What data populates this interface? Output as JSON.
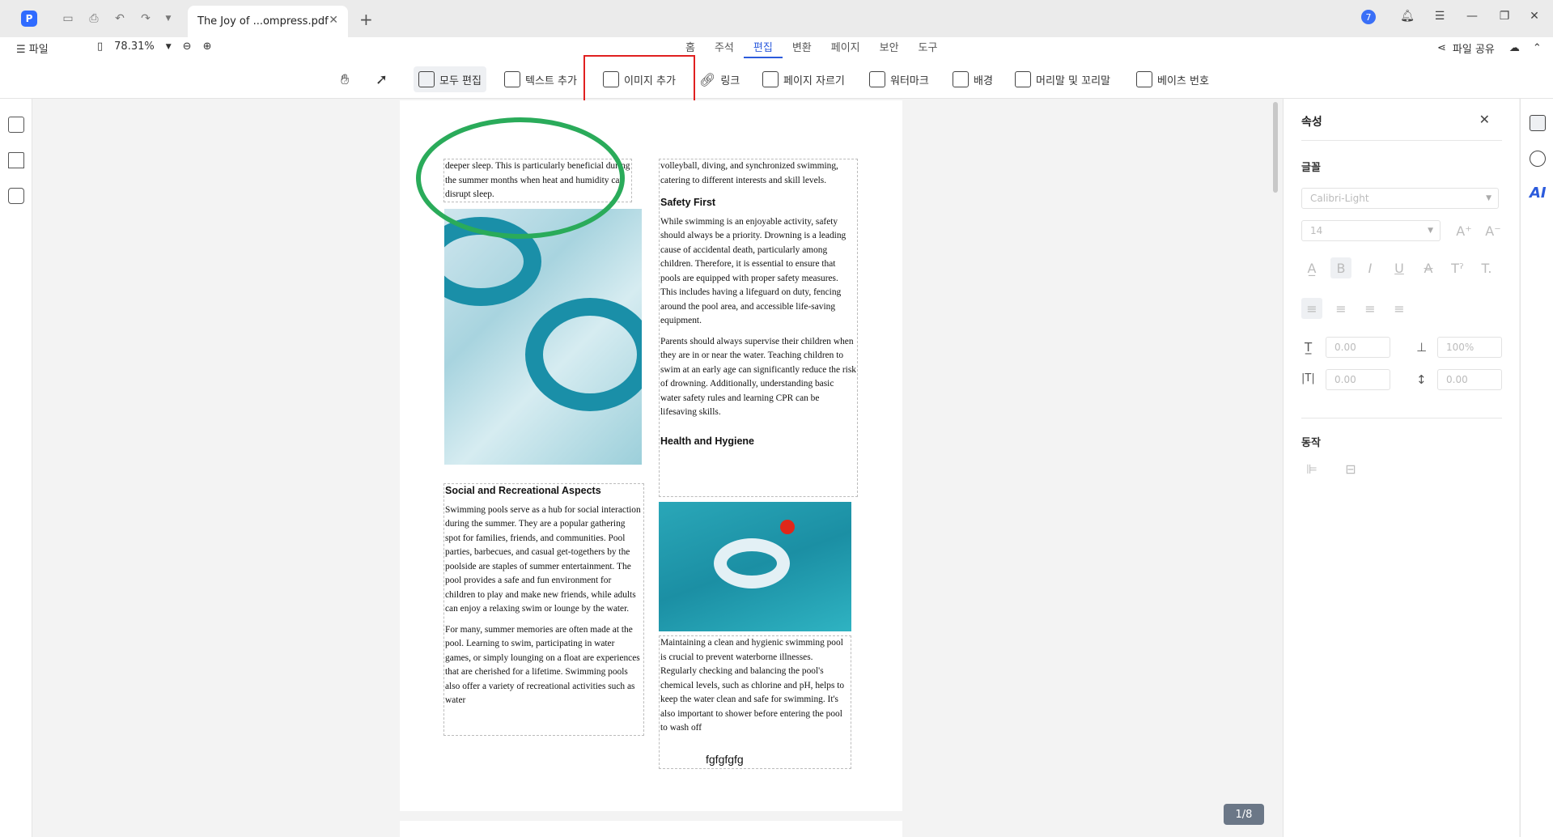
{
  "titlebar": {
    "tab_title": "The Joy of ...ompress.pdf",
    "notification_count": "7"
  },
  "menubar": {
    "file_label": "파일",
    "zoom_value": "78.31%",
    "tabs": [
      "홈",
      "주석",
      "편집",
      "변환",
      "페이지",
      "보안",
      "도구"
    ],
    "active_tab": "편집",
    "share_label": "파일 공유"
  },
  "toolbar": {
    "edit_all": "모두 편집",
    "add_text": "텍스트 추가",
    "add_image": "이미지 추가",
    "link": "링크",
    "crop_page": "페이지 자르기",
    "watermark": "워터마크",
    "background": "배경",
    "header_footer": "머리말 및 꼬리말",
    "bates": "베이츠 번호"
  },
  "document": {
    "left_top_text": "deeper sleep. This is particularly beneficial during the summer months when heat and humidity can disrupt sleep.",
    "social_heading": "Social and Recreational Aspects",
    "social_p1": "Swimming pools serve as a hub for social interaction during the summer. They are a popular gathering spot for families, friends, and communities. Pool parties, barbecues, and casual get-togethers by the poolside are staples of summer entertainment. The pool provides a safe and fun environment for children to play and make new friends, while adults can enjoy a relaxing swim or lounge by the water.",
    "social_p2": "For many, summer memories are often made at the pool. Learning to swim, participating in water games, or simply lounging on a float are experiences that are cherished for a lifetime. Swimming pools also offer a variety of recreational activities such as water",
    "right_top_text": "volleyball, diving, and synchronized swimming, catering to different interests and skill levels.",
    "safety_heading": "Safety First",
    "safety_p1": "While swimming is an enjoyable activity, safety should always be a priority. Drowning is a leading cause of accidental death, particularly among children. Therefore, it is essential to ensure that pools are equipped with proper safety measures. This includes having a lifeguard on duty, fencing around the pool area, and accessible life-saving equipment.",
    "safety_p2": "Parents should always supervise their children when they are in or near the water. Teaching children to swim at an early age can significantly reduce the risk of drowning. Additionally, understanding basic water safety rules and learning CPR can be lifesaving skills.",
    "health_heading": "Health and Hygiene",
    "health_p1": "Maintaining a clean and hygienic swimming pool is crucial to prevent waterborne illnesses. Regularly checking and balancing the pool's chemical levels, such as chlorine and pH, helps to keep the water clean and safe for swimming. It's also important to shower before entering the pool to wash off",
    "extra_text": "fgfgfgfg",
    "page_indicator": "1/8"
  },
  "properties": {
    "title": "속성",
    "font_section": "글꼴",
    "font_name": "Calibri-Light",
    "font_size": "14",
    "char_spacing": "0.00",
    "scale": "100%",
    "word_spacing": "0.00",
    "line_spacing": "0.00",
    "action_section": "동작"
  }
}
